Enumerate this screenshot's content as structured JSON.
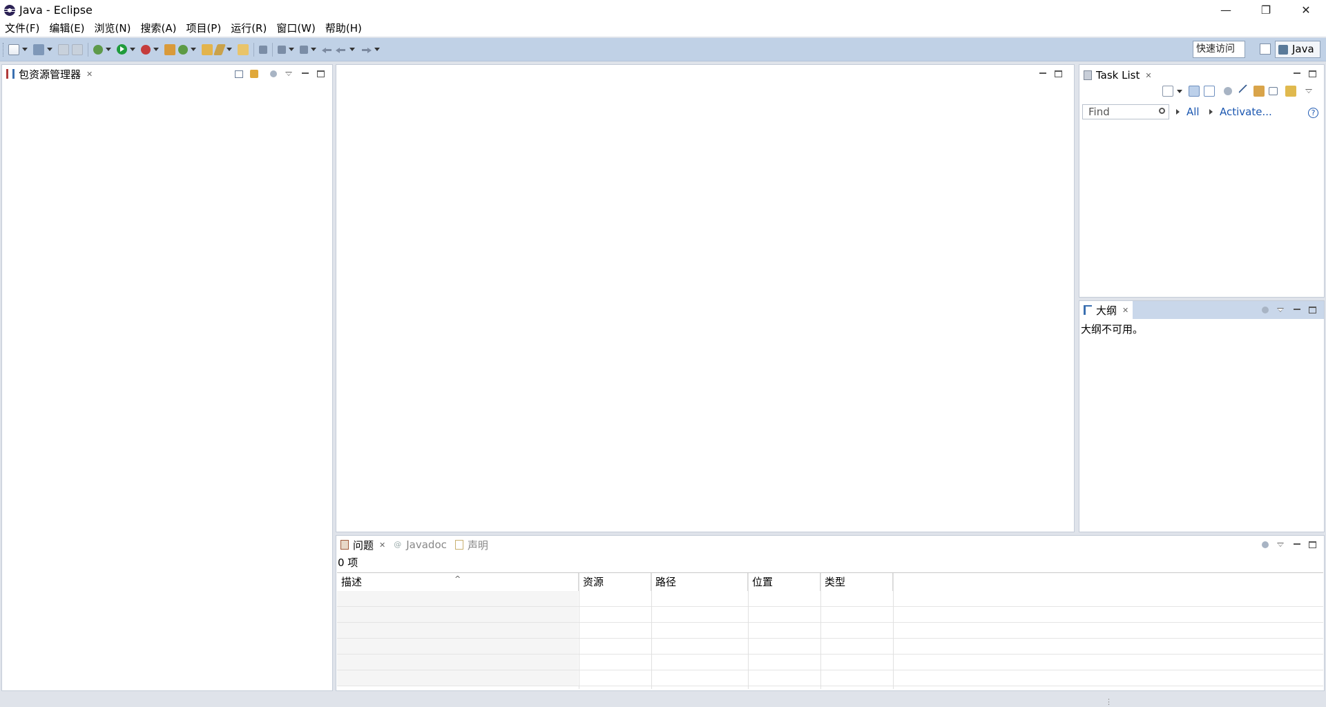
{
  "window": {
    "title": "Java - Eclipse",
    "controls": {
      "minimize": "—",
      "restore": "❐",
      "close": "✕"
    }
  },
  "menu": [
    "文件(F)",
    "编辑(E)",
    "浏览(N)",
    "搜索(A)",
    "项目(P)",
    "运行(R)",
    "窗口(W)",
    "帮助(H)"
  ],
  "toolbar": {
    "quick_access": "快速访问",
    "perspective": "Java"
  },
  "package_explorer": {
    "tab_label": "包资源管理器"
  },
  "task_list": {
    "tab_label": "Task List",
    "find_placeholder": "Find",
    "all_link": "All",
    "activate_link": "Activate...",
    "help": "?"
  },
  "outline": {
    "tab_label": "大纲",
    "message": "大纲不可用。"
  },
  "problems": {
    "tabs": [
      "问题",
      "Javadoc",
      "声明"
    ],
    "count": "0 项",
    "columns": [
      "描述",
      "资源",
      "路径",
      "位置",
      "类型"
    ],
    "sort_indicator": "^"
  },
  "colors": {
    "toolbar_bg": "#c0d1e6",
    "active_tab_bg": "#c9d7ea",
    "link": "#1a56b0",
    "workbench_bg": "#dfe3ea"
  }
}
